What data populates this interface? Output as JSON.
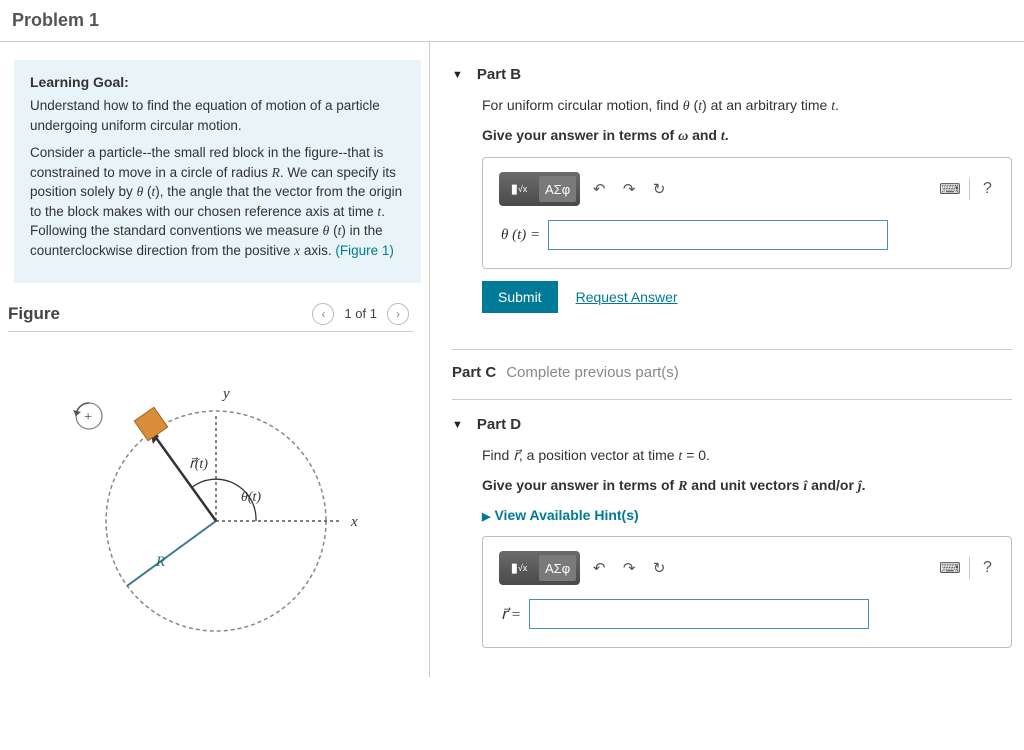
{
  "header": {
    "title": "Problem 1"
  },
  "goal": {
    "heading": "Learning Goal:",
    "p1a": "Understand how to find the equation of motion of a particle undergoing uniform circular motion.",
    "p2": "Consider a particle--the small red block in the figure--that is constrained to move in a circle of radius R. We can specify its position solely by θ (t), the angle that the vector from the origin to the block makes with our chosen reference axis at time t. Following the standard conventions we measure θ (t) in the counterclockwise direction from the positive x axis. ",
    "figlink": "(Figure 1)"
  },
  "figure": {
    "heading": "Figure",
    "nav": "1 of 1",
    "labels": {
      "y": "y",
      "x": "x",
      "r": "r(t)",
      "theta": "θ(t)",
      "R": "R",
      "plus": "+"
    }
  },
  "partB": {
    "caret": "▼",
    "title": "Part B",
    "desc": "For uniform circular motion, find θ (t) at an arbitrary time t.",
    "instr": "Give your answer in terms of ω and t.",
    "label": "θ (t) =",
    "value": ""
  },
  "toolbar": {
    "templates": "√x",
    "greek": "ΑΣφ",
    "undo": "↶",
    "redo": "↷",
    "reset": "↻",
    "keyboard": "⌨",
    "help": "?"
  },
  "actions": {
    "submit": "Submit",
    "request": "Request Answer"
  },
  "partC": {
    "title": "Part C",
    "msg": "Complete previous part(s)"
  },
  "partD": {
    "caret": "▼",
    "title": "Part D",
    "desc": "Find r⃗, a position vector at time t = 0.",
    "instr": "Give your answer in terms of R and unit vectors î and/or ĵ.",
    "hints": "View Available Hint(s)",
    "label": "r⃗ =",
    "value": ""
  }
}
